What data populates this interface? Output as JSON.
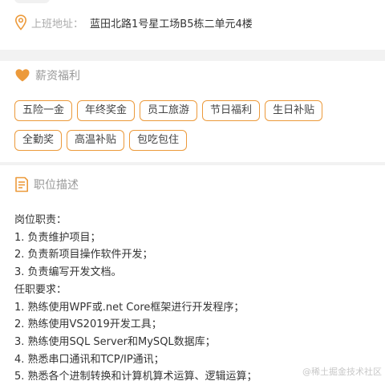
{
  "address": {
    "label": "上班地址：",
    "value": "蓝田北路1号星工场B5栋二单元4楼"
  },
  "welfare": {
    "title": "薪资福利",
    "tags": [
      "五险一金",
      "年终奖金",
      "员工旅游",
      "节日福利",
      "生日补贴",
      "全勤奖",
      "高温补贴",
      "包吃包住"
    ]
  },
  "description": {
    "title": "职位描述",
    "lines": [
      "岗位职责：",
      "1. 负责维护项目；",
      "2. 负责新项目操作软件开发；",
      "3. 负责编写开发文档。",
      "任职要求：",
      "1. 熟练使用WPF或.net Core框架进行开发程序；",
      "2. 熟练使用VS2019开发工具；",
      "3. 熟练使用SQL Server和MySQL数据库；",
      "4. 熟悉串口通讯和TCP/IP通讯；",
      "5. 熟悉各个进制转换和计算机算术运算、逻辑运算；"
    ]
  },
  "watermark": "@稀土掘金技术社区",
  "colors": {
    "accent": "#ec9a3b",
    "background": "#f2f2f2"
  }
}
